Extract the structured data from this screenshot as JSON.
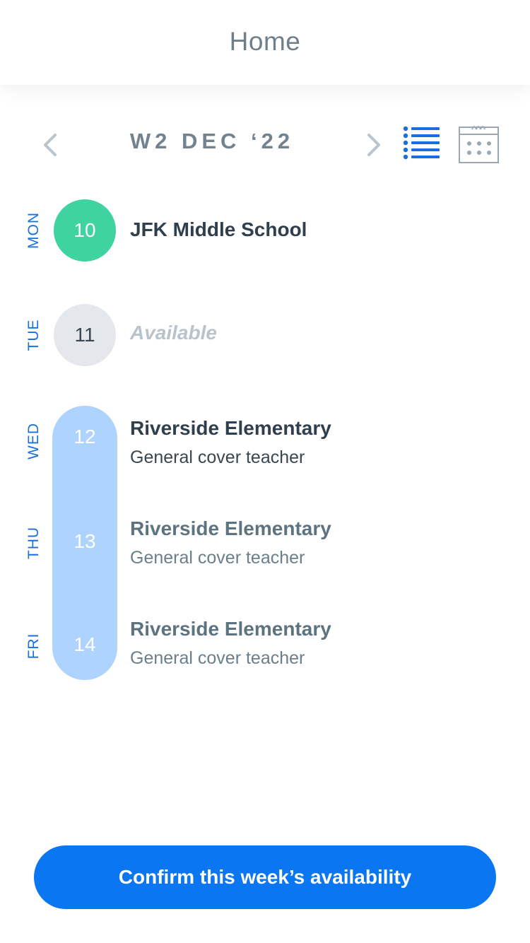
{
  "header": {
    "title": "Home"
  },
  "week_nav": {
    "label": "W2 DEC ‘22",
    "prev_icon": "chevron-left-icon",
    "next_icon": "chevron-right-icon",
    "list_view_icon": "list-view-icon",
    "calendar_view_icon": "calendar-view-icon",
    "active_color": "#1a6fe0",
    "inactive_color": "#9aa8b4"
  },
  "days": [
    {
      "day": "MON",
      "date": "10",
      "school": "JFK Middle School",
      "role": "",
      "status": "booked"
    },
    {
      "day": "TUE",
      "date": "11",
      "status_text": "Available",
      "status": "available"
    },
    {
      "day": "WED",
      "date": "12",
      "school": "Riverside Elementary",
      "role": "General cover teacher",
      "status": "pending"
    },
    {
      "day": "THU",
      "date": "13",
      "school": "Riverside Elementary",
      "role": "General cover teacher",
      "status": "pending"
    },
    {
      "day": "FRI",
      "date": "14",
      "school": "Riverside Elementary",
      "role": "General cover teacher",
      "status": "pending"
    }
  ],
  "colors": {
    "booked": "#3fd3a0",
    "available": "#e4e8ec",
    "pending": "#aed3fe",
    "primary": "#0a76f1"
  },
  "confirm_button": {
    "label": "Confirm this week’s availability"
  }
}
